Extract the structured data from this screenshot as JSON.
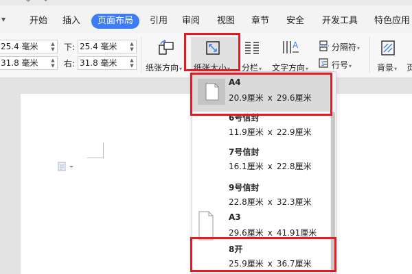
{
  "tabs": [
    {
      "label": "开始"
    },
    {
      "label": "插入"
    },
    {
      "label": "页面布局",
      "active": true
    },
    {
      "label": "引用"
    },
    {
      "label": "审阅"
    },
    {
      "label": "视图"
    },
    {
      "label": "章节"
    },
    {
      "label": "安全"
    },
    {
      "label": "开发工具"
    },
    {
      "label": "特色应用"
    }
  ],
  "margins": {
    "top": "25.4 毫米",
    "left": "31.8 毫米",
    "bottom_label": "下:",
    "bottom": "25.4 毫米",
    "right_label": "右:",
    "right": "31.8 毫米"
  },
  "ribbon": {
    "orientation": "纸张方向",
    "size": "纸张大小",
    "columns": "分栏",
    "text_direction": "文字方向",
    "separator": "分隔符",
    "line_number": "行号",
    "background": "背景",
    "page_border_partial": "页"
  },
  "paper_sizes": [
    {
      "name": "A4",
      "width": "20.9厘米",
      "height": "29.6厘米",
      "selected": true
    },
    {
      "name": "6号信封",
      "width": "11.9厘米",
      "height": "22.9厘米"
    },
    {
      "name": "7号信封",
      "width": "16.1厘米",
      "height": "22.8厘米"
    },
    {
      "name": "9号信封",
      "width": "22.8厘米",
      "height": "32.3厘米"
    },
    {
      "name": "A3",
      "width": "29.6厘米",
      "height": "41.91厘米"
    },
    {
      "name": "8开",
      "width": "25.9厘米",
      "height": "36.7厘米"
    }
  ],
  "times": "x",
  "colors": {
    "accent": "#3d7cf2",
    "highlight": "#e01b22",
    "selected_bg": "#dadada"
  }
}
